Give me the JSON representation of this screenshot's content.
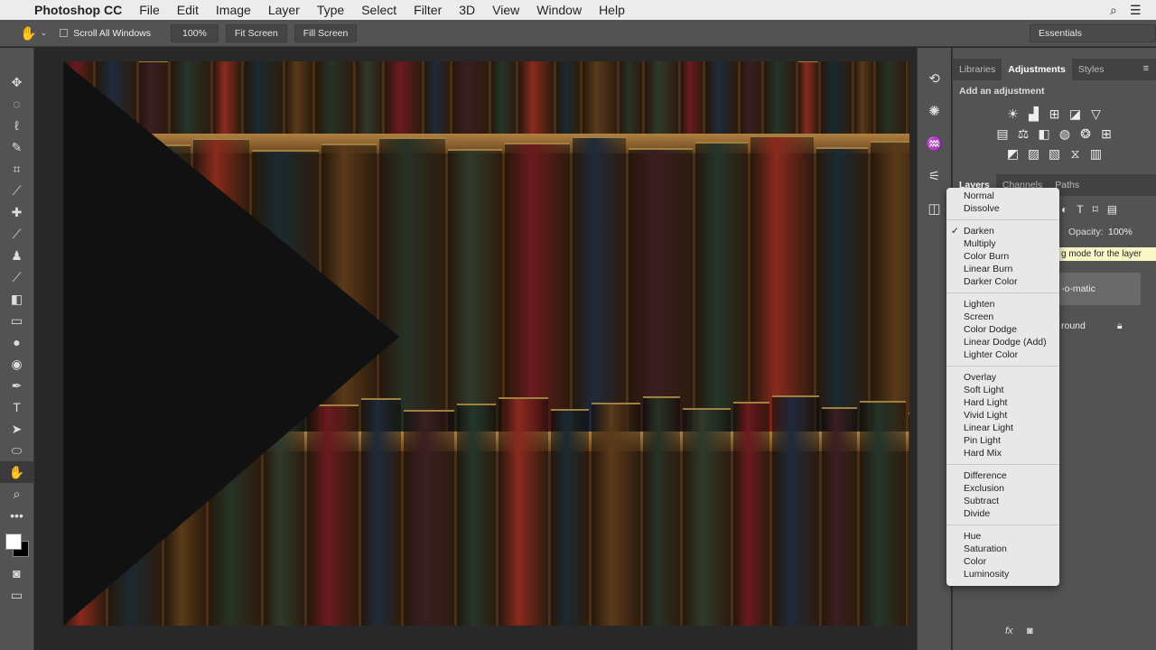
{
  "menubar": {
    "app": "Photoshop CC",
    "items": [
      "File",
      "Edit",
      "Image",
      "Layer",
      "Type",
      "Select",
      "Filter",
      "3D",
      "View",
      "Window",
      "Help"
    ]
  },
  "options": {
    "scroll_all": "Scroll All Windows",
    "zoom": "100%",
    "fit": "Fit Screen",
    "fill": "Fill Screen",
    "workspace": "Essentials"
  },
  "panel": {
    "tabs": [
      "Libraries",
      "Adjustments",
      "Styles"
    ],
    "add_adjustment": "Add an adjustment",
    "layer_tabs": [
      "Layers",
      "Channels",
      "Paths"
    ],
    "opacity_label": "Opacity:",
    "opacity": "100%",
    "tooltip": "g mode for the layer",
    "layers": [
      "-o-matic",
      "round"
    ]
  },
  "blend_modes": {
    "selected": "Darken",
    "groups": [
      [
        "Normal",
        "Dissolve"
      ],
      [
        "Darken",
        "Multiply",
        "Color Burn",
        "Linear Burn",
        "Darker Color"
      ],
      [
        "Lighten",
        "Screen",
        "Color Dodge",
        "Linear Dodge (Add)",
        "Lighter Color"
      ],
      [
        "Overlay",
        "Soft Light",
        "Hard Light",
        "Vivid Light",
        "Linear Light",
        "Pin Light",
        "Hard Mix"
      ],
      [
        "Difference",
        "Exclusion",
        "Subtract",
        "Divide"
      ],
      [
        "Hue",
        "Saturation",
        "Color",
        "Luminosity"
      ]
    ]
  }
}
